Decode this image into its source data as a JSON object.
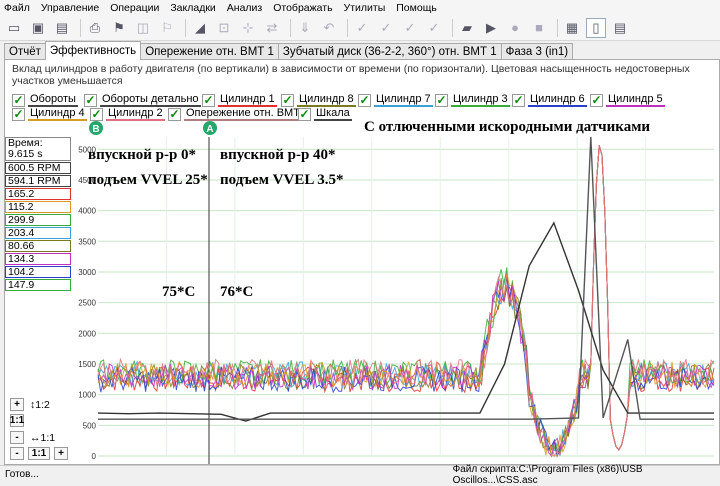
{
  "menu": [
    "Файл",
    "Управление",
    "Операции",
    "Закладки",
    "Анализ",
    "Отображать",
    "Утилиты",
    "Помощь"
  ],
  "tabs": [
    "Отчёт",
    "Эффективность",
    "Опережение отн. ВМТ 1",
    "Зубчатый диск (36-2-2, 360°) отн. ВМТ 1",
    "Фаза 3 (in1)"
  ],
  "selected_tab": "Эффективность",
  "description": "Вклад цилиндров в работу двигателя (по вертикали) в зависимости от времени (по горизонтали). Цветовая насыщенность недостоверных участков уменьшается",
  "legend": [
    {
      "label": "Обороты",
      "color": "#444444"
    },
    {
      "label": "Обороты детально",
      "color": "#444444"
    },
    {
      "label": "Цилиндр 1",
      "color": "#e0302f"
    },
    {
      "label": "Цилиндр 8",
      "color": "#7a7a20"
    },
    {
      "label": "Цилиндр 7",
      "color": "#3aa0d8"
    },
    {
      "label": "Цилиндр 3",
      "color": "#3bab3b"
    },
    {
      "label": "Цилиндр 6",
      "color": "#2a40c8"
    },
    {
      "label": "Цилиндр 5",
      "color": "#c030c0"
    },
    {
      "label": "Цилиндр 4",
      "color": "#d89a20"
    },
    {
      "label": "Цилиндр 2",
      "color": "#e07080"
    },
    {
      "label": "Опережение отн. ВМТ",
      "color": "#b08080"
    },
    {
      "label": "Шкала",
      "color": "#444444"
    }
  ],
  "markers": {
    "a": "A",
    "b": "B"
  },
  "readouts": {
    "time_label": "Время:",
    "time_value": "9.615 s",
    "values": [
      {
        "text": "600.5 RPM",
        "color": "#444444"
      },
      {
        "text": "594.1 RPM",
        "color": "#444444"
      },
      {
        "text": "165.2",
        "color": "#e0302f"
      },
      {
        "text": "115.2",
        "color": "#d89a20"
      },
      {
        "text": "299.9",
        "color": "#3bab3b"
      },
      {
        "text": "203.4",
        "color": "#3aa0d8"
      },
      {
        "text": "80.66",
        "color": "#7a7a20"
      },
      {
        "text": "134.3",
        "color": "#c030c0"
      },
      {
        "text": "104.2",
        "color": "#2a40c8"
      },
      {
        "text": "147.9",
        "color": "#3bab3b"
      }
    ]
  },
  "zoom": {
    "vertical_ratio": "1:2",
    "horizontal_ratio": "1:1",
    "plus": "+",
    "minus": "-",
    "reset": "1:1"
  },
  "annotations": {
    "title": "С отлюченными искородными датчиками",
    "left_valve": "впускной р-р 0*",
    "left_lift": "подъем VVEL 25*",
    "right_valve": "впускной р-р 40*",
    "right_lift": "подъем VVEL 3.5*",
    "left_temp": "75*С",
    "right_temp": "76*С"
  },
  "status": {
    "left": "Готов...",
    "right": "Файл скрипта:C:\\Program Files (x86)\\USB Oscillos...\\CSS.asc"
  },
  "chart_data": {
    "type": "line",
    "yticks": [
      0,
      500,
      1000,
      1500,
      2000,
      2500,
      3000,
      3500,
      4000,
      4500,
      5000
    ],
    "ylim": [
      0,
      5200
    ],
    "series": [
      {
        "name": "Обороты",
        "color": "#333333",
        "x": [
          0,
          0.05,
          0.1,
          0.2,
          0.24,
          0.28,
          0.38,
          0.5,
          0.62,
          0.66,
          0.7,
          0.74,
          0.78,
          0.82,
          0.86,
          0.9,
          0.95,
          1.0
        ],
        "y": [
          700,
          690,
          700,
          680,
          570,
          700,
          700,
          700,
          700,
          1500,
          3100,
          3800,
          2700,
          1400,
          700,
          700,
          700,
          700
        ]
      },
      {
        "name": "Обороты детально",
        "color": "#555555",
        "x": [
          0,
          0.6,
          0.7,
          0.78,
          0.8,
          0.82,
          0.86,
          0.88,
          0.9,
          1.0
        ],
        "y": [
          600,
          600,
          600,
          620,
          5200,
          620,
          1900,
          600,
          600,
          600
        ]
      }
    ]
  }
}
